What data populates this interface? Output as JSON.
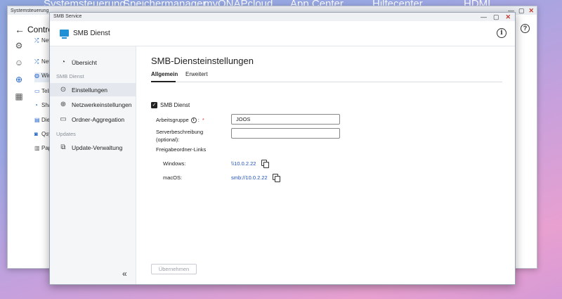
{
  "desktop": {
    "apps": [
      "Systemsteuerung",
      "Speichermanager",
      "myQNAPcloud",
      "App Center",
      "Hilfecenter",
      "HDMI"
    ]
  },
  "back_window": {
    "title": "Systemsteuerung",
    "header_title": "Control",
    "items": [
      {
        "label": "Netzwerk Sicherheit",
        "icon": "network-icon"
      },
      {
        "label": "Netzwerk",
        "icon": "network-icon"
      },
      {
        "label": "Win",
        "icon": "globe-icon"
      },
      {
        "label": "Telnet",
        "icon": "terminal-icon"
      },
      {
        "label": "Share",
        "icon": "share-icon"
      },
      {
        "label": "Dienst",
        "icon": "service-icon"
      },
      {
        "label": "Qsync",
        "icon": "qsync-icon"
      },
      {
        "label": "Papierkorb",
        "icon": "trash-icon"
      }
    ]
  },
  "window": {
    "title": "SMB Service",
    "app_name": "SMB Dienst"
  },
  "sidebar": {
    "overview": "Übersicht",
    "group_smb": "SMB Dienst",
    "items": [
      {
        "label": "Einstellungen",
        "icon": "settings-icon",
        "active": true
      },
      {
        "label": "Netzwerkeinstellungen",
        "icon": "globe-icon",
        "active": false
      },
      {
        "label": "Ordner-Aggregation",
        "icon": "folder-icon",
        "active": false
      }
    ],
    "group_updates": "Updates",
    "update_item": "Update-Verwaltung"
  },
  "main": {
    "title": "SMB-Diensteinstellungen",
    "tabs": [
      {
        "label": "Allgemein",
        "active": true
      },
      {
        "label": "Erweitert",
        "active": false
      }
    ],
    "smb_checkbox_label": "SMB Dienst",
    "smb_checked": true,
    "workgroup_label": "Arbeitsgruppe",
    "workgroup_required": "*",
    "workgroup_value": "JOOS",
    "server_desc_label_1": "Serverbeschreibung",
    "server_desc_label_2": "(optional):",
    "server_desc_value": "",
    "share_links_label": "Freigabeordner-Links",
    "windows_label": "Windows:",
    "windows_link": "\\\\10.0.2.22",
    "macos_label": "macOS:",
    "macos_link": "smb://10.0.2.22",
    "apply_button": "Übernehmen"
  }
}
